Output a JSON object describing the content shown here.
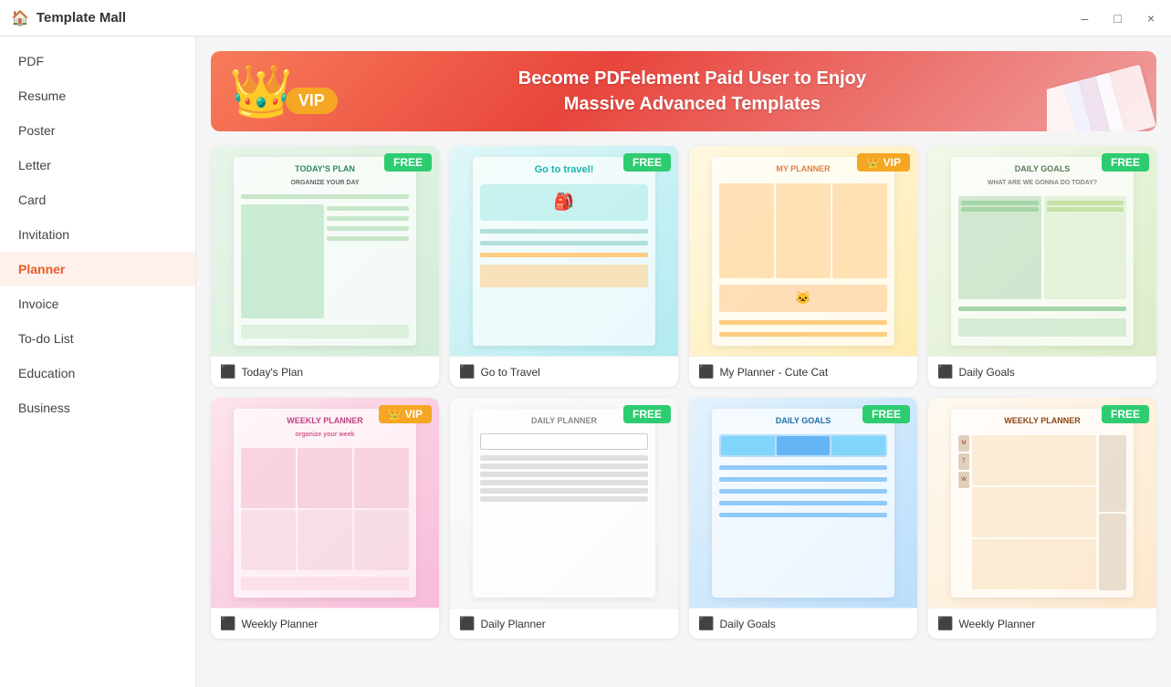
{
  "titleBar": {
    "title": "Template Mall",
    "icon": "🏠",
    "controls": {
      "minimize": "–",
      "maximize": "□",
      "close": "×"
    }
  },
  "sidebar": {
    "items": [
      {
        "id": "pdf",
        "label": "PDF"
      },
      {
        "id": "resume",
        "label": "Resume"
      },
      {
        "id": "poster",
        "label": "Poster"
      },
      {
        "id": "letter",
        "label": "Letter"
      },
      {
        "id": "card",
        "label": "Card"
      },
      {
        "id": "invitation",
        "label": "Invitation"
      },
      {
        "id": "planner",
        "label": "Planner",
        "active": true
      },
      {
        "id": "invoice",
        "label": "Invoice"
      },
      {
        "id": "todo",
        "label": "To-do List"
      },
      {
        "id": "education",
        "label": "Education"
      },
      {
        "id": "business",
        "label": "Business"
      }
    ]
  },
  "banner": {
    "line1": "Become PDFelement Paid User to Enjoy",
    "line2": "Massive Advanced Templates",
    "vipLabel": "VIP"
  },
  "templates": {
    "row1": [
      {
        "name": "Today's Plan",
        "badge": "FREE",
        "badgeType": "free",
        "thumbClass": "thumb-plan1",
        "headerText": "TODAY'S PLAN",
        "headerColor": "#2d8a60"
      },
      {
        "name": "Go to Travel",
        "badge": "FREE",
        "badgeType": "free",
        "thumbClass": "thumb-plan2",
        "headerText": "Go to travel!",
        "headerColor": "#20b2aa"
      },
      {
        "name": "My Planner - Cute Cat",
        "badge": "VIP",
        "badgeType": "vip",
        "thumbClass": "thumb-plan3",
        "headerText": "MY PLANNER",
        "headerColor": "#e08040"
      },
      {
        "name": "Daily Goals",
        "badge": "FREE",
        "badgeType": "free",
        "thumbClass": "thumb-plan4",
        "headerText": "DAILY GOALS",
        "headerColor": "#5a7a5a"
      }
    ],
    "row2": [
      {
        "name": "Weekly Planner",
        "badge": "VIP",
        "badgeType": "vip",
        "thumbClass": "thumb-plan5",
        "headerText": "WEEKLY PLANNER",
        "headerColor": "#c04080"
      },
      {
        "name": "Daily Planner",
        "badge": "FREE",
        "badgeType": "free",
        "thumbClass": "thumb-plan6",
        "headerText": "DAILY PLANNER",
        "headerColor": "#888"
      },
      {
        "name": "Daily Goals",
        "badge": "FREE",
        "badgeType": "free",
        "thumbClass": "thumb-plan7",
        "headerText": "DAILY GOALS",
        "headerColor": "#1a6fa8"
      },
      {
        "name": "Weekly Planner",
        "badge": "FREE",
        "badgeType": "free",
        "thumbClass": "thumb-plan8",
        "headerText": "WEEKLY PLANNER",
        "headerColor": "#8b4513"
      }
    ]
  }
}
